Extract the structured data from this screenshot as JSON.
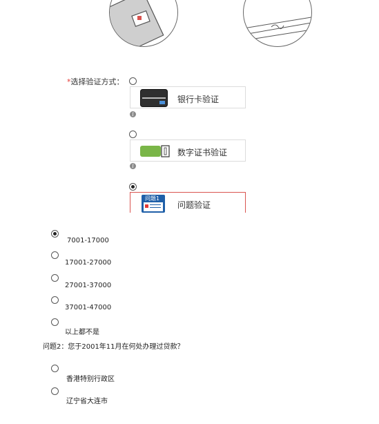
{
  "verify": {
    "required_mark": "*",
    "label": "选择验证方式：",
    "methods": [
      {
        "label": "银行卡验证",
        "icon": "bank-card-icon",
        "selected": false
      },
      {
        "label": "数字证书验证",
        "icon": "usb-key-icon",
        "selected": false
      },
      {
        "label": "问题验证",
        "icon": "question-card-icon",
        "badge": "问题1",
        "selected": true
      }
    ]
  },
  "question1": {
    "options": [
      {
        "label": "7001-17000",
        "selected": true
      },
      {
        "label": "17001-27000",
        "selected": false
      },
      {
        "label": "27001-37000",
        "selected": false
      },
      {
        "label": "37001-47000",
        "selected": false
      },
      {
        "label": "以上都不是",
        "selected": false
      }
    ]
  },
  "question2": {
    "title": "问题2：您于2001年11月在何处办理过贷款？",
    "options": [
      {
        "label": "香港特别行政区",
        "selected": false
      },
      {
        "label": "辽宁省大连市",
        "selected": false
      }
    ]
  },
  "colors": {
    "selected_border": "#d9534f",
    "required": "#e53935",
    "usb_green": "#7ab648",
    "question_blue": "#1f5fa8"
  }
}
